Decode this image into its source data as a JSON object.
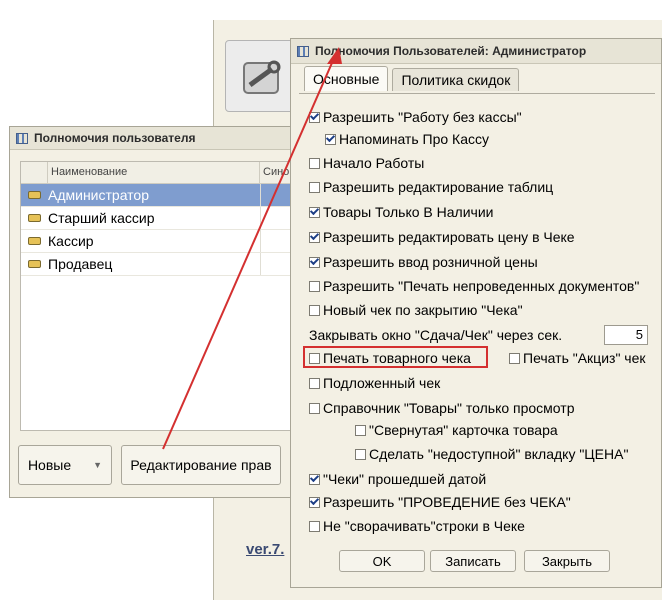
{
  "background": {
    "version_text": "ver.7."
  },
  "left_window": {
    "title": "Полномочия пользователя",
    "columns": [
      "Наименование",
      "Синони"
    ],
    "rows": [
      {
        "name": "Администратор",
        "selected": true
      },
      {
        "name": "Старший кассир",
        "selected": false
      },
      {
        "name": "Кассир",
        "selected": false
      },
      {
        "name": "Продавец",
        "selected": false
      }
    ],
    "buttons": {
      "new_label": "Новые",
      "edit_label": "Редактирование прав"
    }
  },
  "dialog": {
    "title": "Полномочия Пользователей: Администратор",
    "tabs": [
      "Основные",
      "Политика скидок"
    ],
    "options": [
      {
        "label": "Разрешить \"Работу без кассы\"",
        "checked": true
      },
      {
        "label": "Напоминать Про Кассу",
        "checked": true
      },
      {
        "label": "Начало Работы",
        "checked": false
      },
      {
        "label": "Разрешить редактирование таблиц",
        "checked": false
      },
      {
        "label": "Товары Только В Наличии",
        "checked": true
      },
      {
        "label": "Разрешить редактировать цену в Чеке",
        "checked": true
      },
      {
        "label": "Разрешить ввод розничной цены",
        "checked": true
      },
      {
        "label": "Разрешить \"Печать непроведенных документов\"",
        "checked": false
      },
      {
        "label": "Новый чек по закрытию \"Чека\"",
        "checked": false
      },
      {
        "label": "Печать товарного чека",
        "checked": false
      },
      {
        "label": "Печать \"Акциз\" чек",
        "checked": false
      },
      {
        "label": "Подложенный чек",
        "checked": false
      },
      {
        "label": "Справочник \"Товары\" только просмотр",
        "checked": false
      },
      {
        "label": "\"Свернутая\" карточка товара",
        "checked": false
      },
      {
        "label": "Сделать \"недоступной\" вкладку \"ЦЕНА\"",
        "checked": false
      },
      {
        "label": "\"Чеки\" прошедшей датой",
        "checked": true
      },
      {
        "label": "Разрешить \"ПРОВЕДЕНИЕ без ЧЕКА\"",
        "checked": true
      },
      {
        "label": "Не \"сворачивать\"строки в Чеке",
        "checked": false
      }
    ],
    "close_timer": {
      "label": "Закрывать окно \"Сдача/Чек\" через сек.",
      "value": "5"
    },
    "buttons": {
      "ok": "OK",
      "save": "Записать",
      "close": "Закрыть"
    }
  },
  "colors": {
    "highlight_box": "#d43030",
    "arrow": "#d43030",
    "selected_row": "#7f9dcf"
  }
}
